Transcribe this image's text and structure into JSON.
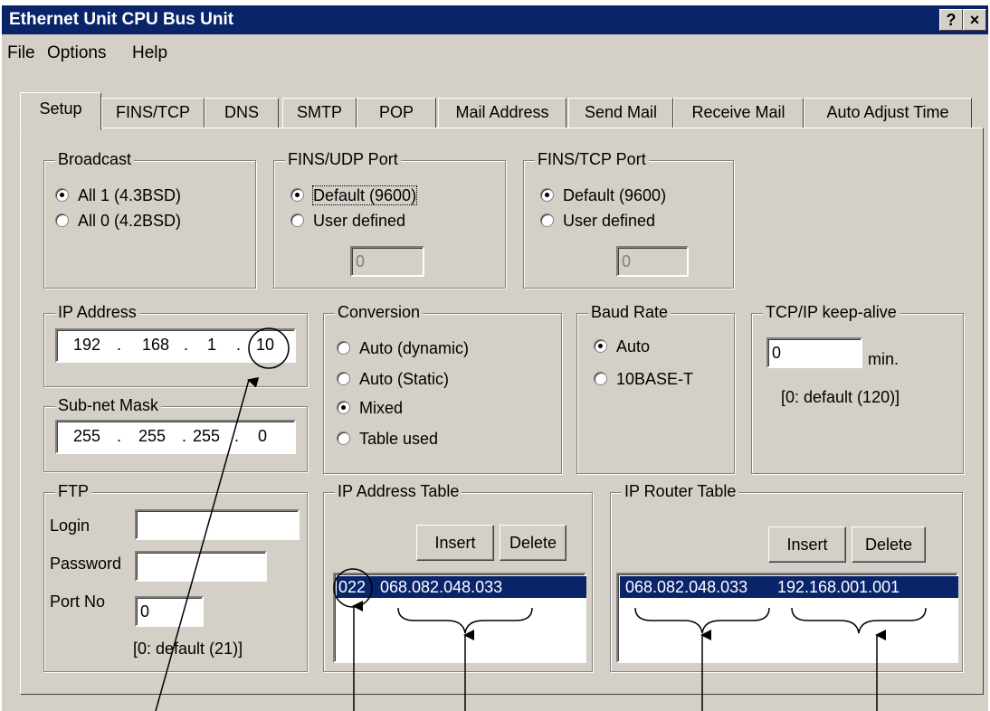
{
  "window": {
    "title": "Ethernet Unit CPU Bus Unit",
    "help_btn": "?",
    "close_btn": "×"
  },
  "menu": [
    "File",
    "Options",
    "Help"
  ],
  "tabs": [
    "Setup",
    "FINS/TCP",
    "DNS",
    "SMTP",
    "POP",
    "Mail Address",
    "Send Mail",
    "Receive Mail",
    "Auto Adjust Time"
  ],
  "broadcast": {
    "title": "Broadcast",
    "opt1": "All 1 (4.3BSD)",
    "opt2": "All 0 (4.2BSD)",
    "selected": 0
  },
  "fins_udp": {
    "title": "FINS/UDP Port",
    "opt1": "Default (9600)",
    "opt2": "User defined",
    "value": "0",
    "selected": 0
  },
  "fins_tcp": {
    "title": "FINS/TCP Port",
    "opt1": "Default (9600)",
    "opt2": "User defined",
    "value": "0",
    "selected": 0
  },
  "ip_address": {
    "title": "IP Address",
    "o1": "192",
    "o2": "168",
    "o3": "1",
    "o4": "10"
  },
  "subnet": {
    "title": "Sub-net Mask",
    "o1": "255",
    "o2": "255",
    "o3": "255",
    "o4": "0"
  },
  "conversion": {
    "title": "Conversion",
    "opt1": "Auto (dynamic)",
    "opt2": "Auto (Static)",
    "opt3": "Mixed",
    "opt4": "Table used",
    "selected": 2
  },
  "baud": {
    "title": "Baud Rate",
    "opt1": "Auto",
    "opt2": "10BASE-T",
    "selected": 0
  },
  "keepalive": {
    "title": "TCP/IP keep-alive",
    "value": "0",
    "unit": "min.",
    "hint": "[0: default (120)]"
  },
  "ftp": {
    "title": "FTP",
    "login_label": "Login",
    "login_value": "",
    "password_label": "Password",
    "password_value": "",
    "port_label": "Port No",
    "port_value": "0",
    "hint": "[0: default (21)]"
  },
  "ip_table": {
    "title": "IP Address Table",
    "insert": "Insert",
    "delete": "Delete",
    "row_node": "022",
    "row_ip": "068.082.048.033"
  },
  "router_table": {
    "title": "IP Router Table",
    "insert": "Insert",
    "delete": "Delete",
    "row_ip1": "068.082.048.033",
    "row_ip2": "192.168.001.001"
  }
}
